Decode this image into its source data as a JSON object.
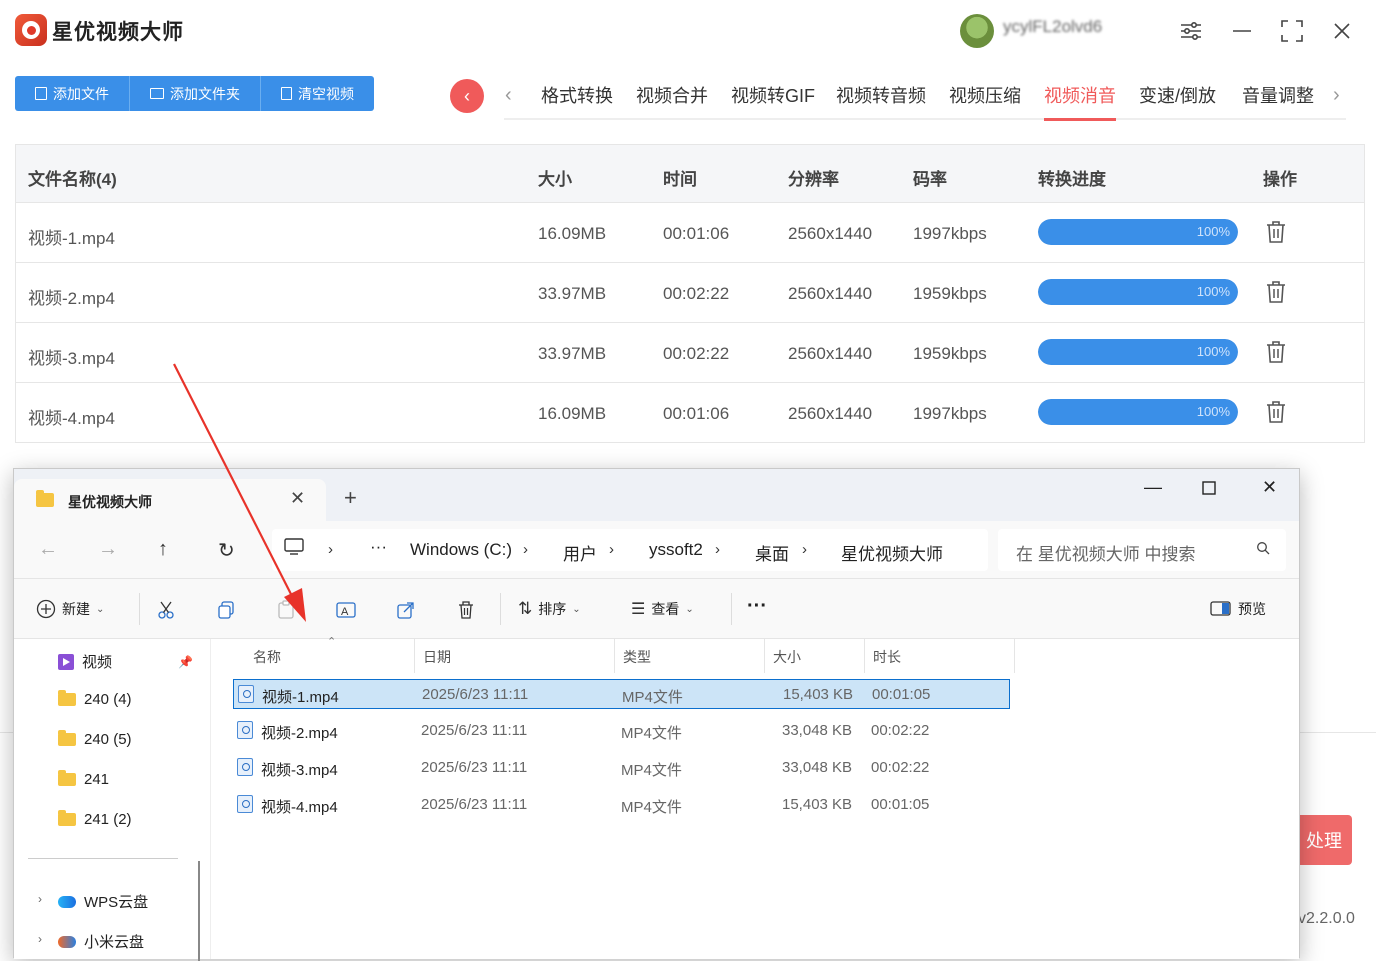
{
  "app": {
    "title": "星优视频大师",
    "username": "ycylFL2olvd6",
    "toolbar": [
      {
        "label": "添加文件",
        "icon": "file-icon"
      },
      {
        "label": "添加文件夹",
        "icon": "folder-icon"
      },
      {
        "label": "清空视频",
        "icon": "trash-icon"
      }
    ],
    "tabs": [
      "格式转换",
      "视频合并",
      "视频转GIF",
      "视频转音频",
      "视频压缩",
      "视频消音",
      "变速/倒放",
      "音量调整"
    ],
    "active_tab": "视频消音",
    "table": {
      "headers": {
        "name": "文件名称(4)",
        "size": "大小",
        "time": "时间",
        "resolution": "分辨率",
        "bitrate": "码率",
        "progress": "转换进度",
        "action": "操作"
      },
      "rows": [
        {
          "name": "视频-1.mp4",
          "size": "16.09MB",
          "time": "00:01:06",
          "resolution": "2560x1440",
          "bitrate": "1997kbps",
          "progress": "100%",
          "progress_value": 1.0
        },
        {
          "name": "视频-2.mp4",
          "size": "33.97MB",
          "time": "00:02:22",
          "resolution": "2560x1440",
          "bitrate": "1959kbps",
          "progress": "100%",
          "progress_value": 1.0
        },
        {
          "name": "视频-3.mp4",
          "size": "33.97MB",
          "time": "00:02:22",
          "resolution": "2560x1440",
          "bitrate": "1959kbps",
          "progress": "100%",
          "progress_value": 1.0
        },
        {
          "name": "视频-4.mp4",
          "size": "16.09MB",
          "time": "00:01:06",
          "resolution": "2560x1440",
          "bitrate": "1997kbps",
          "progress": "100%",
          "progress_value": 1.0
        }
      ]
    },
    "process_button": "处理",
    "version": "v2.2.0.0",
    "colors": {
      "accent_blue": "#3a8fe8",
      "accent_red": "#f05a5a"
    }
  },
  "explorer": {
    "tab_title": "星优视频大师",
    "new_tab": "+",
    "breadcrumb": [
      "Windows (C:)",
      "用户",
      "yssoft2",
      "桌面",
      "星优视频大师"
    ],
    "search_placeholder": "在 星优视频大师 中搜索",
    "commands": {
      "new": "新建",
      "sort": "排序",
      "view": "查看",
      "more": "···",
      "preview": "预览"
    },
    "sidebar": [
      {
        "label": "视频",
        "icon": "video-icon",
        "pinned": true
      },
      {
        "label": "240 (4)",
        "icon": "folder-icon"
      },
      {
        "label": "240 (5)",
        "icon": "folder-icon"
      },
      {
        "label": "241",
        "icon": "folder-icon"
      },
      {
        "label": "241 (2)",
        "icon": "folder-icon"
      },
      {
        "label": "WPS云盘",
        "icon": "wps-cloud-icon"
      },
      {
        "label": "小米云盘",
        "icon": "mi-cloud-icon"
      }
    ],
    "columns": {
      "name": "名称",
      "date": "日期",
      "type": "类型",
      "size": "大小",
      "duration": "时长"
    },
    "files": [
      {
        "name": "视频-1.mp4",
        "date": "2025/6/23 11:11",
        "type": "MP4文件",
        "size": "15,403 KB",
        "duration": "00:01:05",
        "selected": true
      },
      {
        "name": "视频-2.mp4",
        "date": "2025/6/23 11:11",
        "type": "MP4文件",
        "size": "33,048 KB",
        "duration": "00:02:22",
        "selected": false
      },
      {
        "name": "视频-3.mp4",
        "date": "2025/6/23 11:11",
        "type": "MP4文件",
        "size": "33,048 KB",
        "duration": "00:02:22",
        "selected": false
      },
      {
        "name": "视频-4.mp4",
        "date": "2025/6/23 11:11",
        "type": "MP4文件",
        "size": "15,403 KB",
        "duration": "00:01:05",
        "selected": false
      }
    ]
  }
}
